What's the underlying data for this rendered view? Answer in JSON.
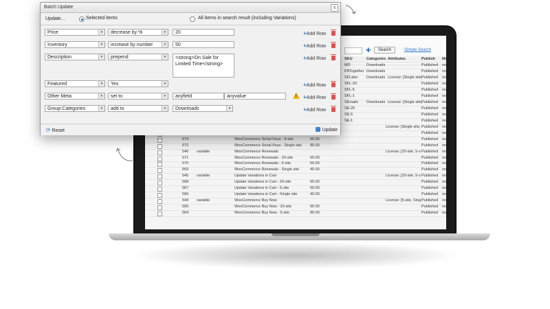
{
  "dialog": {
    "title": "Batch Update",
    "close": "x",
    "update_menu": "Update...",
    "scope_selected": "Selected items",
    "scope_all": "All items in search result (including Variations)",
    "rows": [
      {
        "field": "Price",
        "action": "decrease by %",
        "value": "20"
      },
      {
        "field": "Inventory",
        "action": "increase by number",
        "value": "50"
      },
      {
        "field": "Description",
        "action": "prepend",
        "value": "<strong>On Sale for Limited Time</strong>"
      },
      {
        "field": "Featured",
        "action": "Yes",
        "value": ""
      },
      {
        "field": "Other Meta",
        "action": "set to",
        "value": "anyfield",
        "value2": "anyvalue"
      },
      {
        "field": "Group:Categories",
        "action": "add to",
        "value": "Downloads"
      }
    ],
    "add_row": "Add Row",
    "reset": "Reset",
    "update": "Update"
  },
  "background": {
    "search_button": "Search",
    "simple_search": "Simple Search",
    "headers": [
      "SKU",
      "Categories",
      "Attributes",
      "Publish",
      "Ma"
    ],
    "rows": [
      {
        "sku": "MD",
        "cat": "Downloads",
        "attr": "",
        "pub": "Published",
        "m": "no"
      },
      {
        "sku": "FBTogether",
        "cat": "Downloads",
        "attr": "",
        "pub": "Published",
        "m": "no"
      },
      {
        "sku": "SFLater",
        "cat": "Downloads",
        "attr": "License: [Single site,",
        "pub": "Published",
        "m": "no"
      },
      {
        "sku": "SFL-20",
        "cat": "",
        "attr": "",
        "pub": "Published",
        "m": "no"
      },
      {
        "sku": "SFL-5",
        "cat": "",
        "attr": "",
        "pub": "Published",
        "m": "no"
      },
      {
        "sku": "SFL-1",
        "cat": "",
        "attr": "",
        "pub": "Published",
        "m": "no"
      },
      {
        "sku": "SEmails",
        "cat": "Downloads",
        "attr": "License: [Single site,",
        "pub": "Published",
        "m": "no"
      },
      {
        "sku": "SE-20",
        "cat": "",
        "attr": "",
        "pub": "Published",
        "m": "no"
      },
      {
        "sku": "SE-5",
        "cat": "",
        "attr": "",
        "pub": "Published",
        "m": "no"
      },
      {
        "sku": "SE-1",
        "cat": "",
        "attr": "",
        "pub": "Published",
        "m": "no"
      }
    ],
    "lower_rows": [
      {
        "id": "",
        "type": "",
        "name": "",
        "price": "",
        "attr": "License: [Single site,",
        "pub": "Published",
        "m": "no"
      },
      {
        "id": "574",
        "type": "",
        "name": "WooCommerce Serial Keys - 20-site",
        "price": "100.00",
        "attr": "",
        "pub": "Published",
        "m": "no"
      },
      {
        "id": "573",
        "type": "",
        "name": "WooCommerce Serial Keys - 5-site",
        "price": "90.00",
        "attr": "",
        "pub": "Published",
        "m": "no"
      },
      {
        "id": "572",
        "type": "",
        "name": "WooCommerce Serial Keys - Single site",
        "price": "80.00",
        "attr": "",
        "pub": "Published",
        "m": "no"
      },
      {
        "id": "546",
        "type": "variable",
        "name": "WooCommerce Renewals",
        "price": "",
        "attr": "License: [20-site, 5-s",
        "pub": "Published",
        "m": "no"
      },
      {
        "id": "571",
        "type": "",
        "name": "WooCommerce Renewals - 20-site",
        "price": "60.00",
        "attr": "",
        "pub": "Published",
        "m": "no"
      },
      {
        "id": "570",
        "type": "",
        "name": "WooCommerce Renewals - 5-site",
        "price": "50.00",
        "attr": "",
        "pub": "Published",
        "m": "no"
      },
      {
        "id": "569",
        "type": "",
        "name": "WooCommerce Renewals - Single site",
        "price": "40.00",
        "attr": "",
        "pub": "Published",
        "m": "no"
      },
      {
        "id": "545",
        "type": "variable",
        "name": "Update Variations in Cart",
        "price": "",
        "attr": "License: [20-site, 5-s",
        "pub": "Published",
        "m": "no"
      },
      {
        "id": "568",
        "type": "",
        "name": "Update Variations in Cart - 20-site",
        "price": "60.00",
        "attr": "",
        "pub": "Published",
        "m": "no"
      },
      {
        "id": "567",
        "type": "",
        "name": "Update Variations in Cart - 5-site",
        "price": "50.00",
        "attr": "",
        "pub": "Published",
        "m": "no"
      },
      {
        "id": "566",
        "type": "",
        "name": "Update Variations in Cart - Single site",
        "price": "40.00",
        "attr": "",
        "pub": "Published",
        "m": "no"
      },
      {
        "id": "544",
        "type": "variable",
        "name": "WooCommerce Buy Now",
        "price": "",
        "attr": "License: [5-site, Sing",
        "pub": "Published",
        "m": "no"
      },
      {
        "id": "565",
        "type": "",
        "name": "WooCommerce Buy Now - 20-site",
        "price": "90.00",
        "attr": "",
        "pub": "Published",
        "m": "no"
      },
      {
        "id": "564",
        "type": "",
        "name": "WooCommerce Buy Now - 5-site",
        "price": "80.00",
        "attr": "",
        "pub": "Published",
        "m": "no"
      }
    ]
  }
}
